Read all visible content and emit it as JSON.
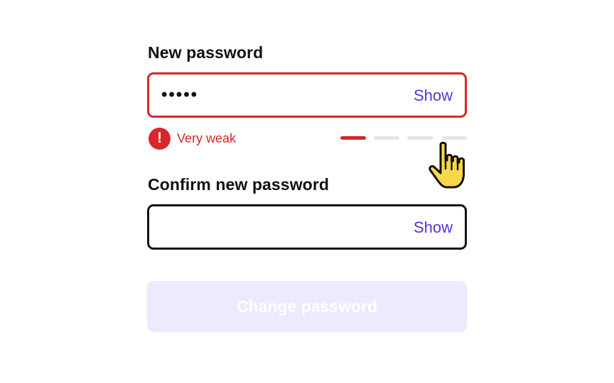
{
  "form": {
    "new_password": {
      "label": "New password",
      "value_masked": "•••••",
      "show_label": "Show",
      "error_text": "Very weak",
      "error_icon_glyph": "!",
      "strength": {
        "filled_segments": 1,
        "total_segments": 4,
        "filled_color": "#d8262b",
        "empty_color": "#e6e6e6"
      }
    },
    "confirm_password": {
      "label": "Confirm new password",
      "value": "",
      "show_label": "Show"
    },
    "submit": {
      "label": "Change password",
      "disabled": true
    }
  },
  "colors": {
    "error": "#d8262b",
    "accent": "#5b2ee0",
    "button_disabled_bg": "#ede9ff",
    "text": "#111111",
    "cursor_fill": "#f7d84a"
  },
  "icons": {
    "error": "exclamation-circle-icon",
    "cursor": "pointing-hand-cursor-icon"
  }
}
